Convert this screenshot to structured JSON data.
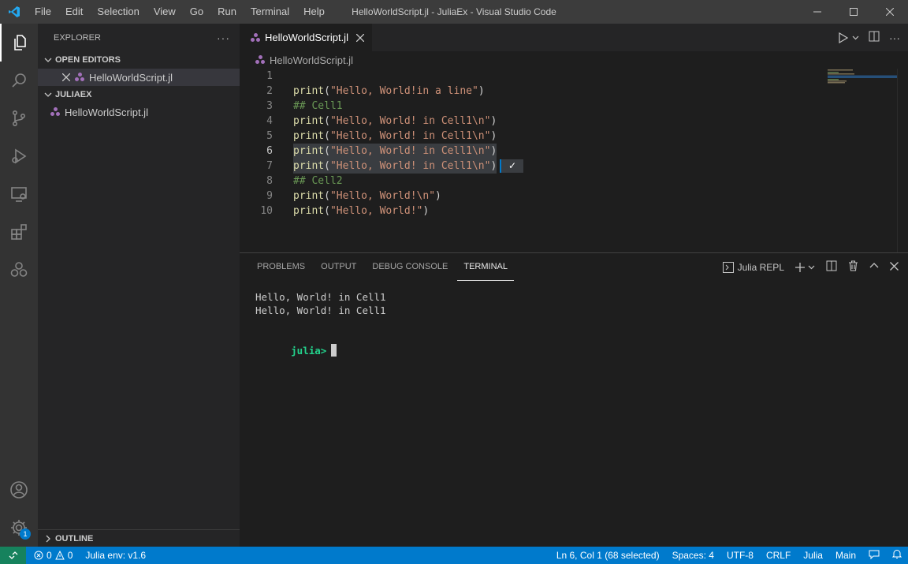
{
  "window": {
    "title": "HelloWorldScript.jl - JuliaEx - Visual Studio Code",
    "menu": [
      "File",
      "Edit",
      "Selection",
      "View",
      "Go",
      "Run",
      "Terminal",
      "Help"
    ]
  },
  "activity_bar": {
    "items": [
      "explorer-icon",
      "search-icon",
      "source-control-icon",
      "run-debug-icon",
      "remote-explorer-icon",
      "extensions-icon",
      "julia-icon"
    ],
    "bottom": [
      "account-icon",
      "settings-gear-icon"
    ],
    "settings_badge": "1"
  },
  "sidebar": {
    "title": "EXPLORER",
    "more": "···",
    "open_editors": {
      "label": "OPEN EDITORS",
      "items": [
        "HelloWorldScript.jl"
      ]
    },
    "workspace": {
      "label": "JULIAEX",
      "items": [
        "HelloWorldScript.jl"
      ]
    },
    "outline": "OUTLINE"
  },
  "editor": {
    "tab": "HelloWorldScript.jl",
    "breadcrumb": "HelloWorldScript.jl",
    "lines": [
      {
        "n": "1",
        "parts": []
      },
      {
        "n": "2",
        "parts": [
          {
            "c": "kw",
            "t": "print"
          },
          {
            "c": "pl",
            "t": "("
          },
          {
            "c": "str",
            "t": "\"Hello, World!in a line\""
          },
          {
            "c": "pl",
            "t": ")"
          }
        ]
      },
      {
        "n": "3",
        "parts": [
          {
            "c": "cm",
            "t": "## Cell1"
          }
        ]
      },
      {
        "n": "4",
        "parts": [
          {
            "c": "kw",
            "t": "print"
          },
          {
            "c": "pl",
            "t": "("
          },
          {
            "c": "str",
            "t": "\"Hello, World! in Cell1\\n\""
          },
          {
            "c": "pl",
            "t": ")"
          }
        ]
      },
      {
        "n": "5",
        "parts": [
          {
            "c": "kw",
            "t": "print"
          },
          {
            "c": "pl",
            "t": "("
          },
          {
            "c": "str",
            "t": "\"Hello, World! in Cell1\\n\""
          },
          {
            "c": "pl",
            "t": ")"
          }
        ]
      },
      {
        "n": "6",
        "parts": [
          {
            "c": "kw",
            "t": "print"
          },
          {
            "c": "pl",
            "t": "("
          },
          {
            "c": "str",
            "t": "\"Hello, World! in Cell1\\n\""
          },
          {
            "c": "pl",
            "t": ")"
          }
        ]
      },
      {
        "n": "7",
        "parts": [
          {
            "c": "kw",
            "t": "print"
          },
          {
            "c": "pl",
            "t": "("
          },
          {
            "c": "str",
            "t": "\"Hello, World! in Cell1\\n\""
          },
          {
            "c": "pl",
            "t": ")"
          }
        ]
      },
      {
        "n": "8",
        "parts": [
          {
            "c": "cm",
            "t": "## Cell2"
          }
        ]
      },
      {
        "n": "9",
        "parts": [
          {
            "c": "kw",
            "t": "print"
          },
          {
            "c": "pl",
            "t": "("
          },
          {
            "c": "str",
            "t": "\"Hello, World!\\n\""
          },
          {
            "c": "pl",
            "t": ")"
          }
        ]
      },
      {
        "n": "10",
        "parts": [
          {
            "c": "kw",
            "t": "print"
          },
          {
            "c": "pl",
            "t": "("
          },
          {
            "c": "str",
            "t": "\"Hello, World!\""
          },
          {
            "c": "pl",
            "t": ")"
          }
        ]
      }
    ],
    "current_line": "6",
    "selected_lines": [
      "6",
      "7"
    ],
    "inline_result": "✓"
  },
  "panel": {
    "tabs": [
      "PROBLEMS",
      "OUTPUT",
      "DEBUG CONSOLE",
      "TERMINAL"
    ],
    "active_tab": "TERMINAL",
    "terminal_name": "Julia REPL",
    "output": [
      "Hello, World! in Cell1",
      "Hello, World! in Cell1"
    ],
    "prompt": "julia>"
  },
  "status_bar": {
    "errors": "0",
    "warnings": "0",
    "julia_env": "Julia env: v1.6",
    "position": "Ln 6, Col 1 (68 selected)",
    "spaces": "Spaces: 4",
    "encoding": "UTF-8",
    "eol": "CRLF",
    "language": "Julia",
    "branch": "Main"
  },
  "colors": {
    "accent": "#007acc",
    "remote": "#16825d",
    "julia_purple": "#a270ba",
    "prompt_green": "#23d18b"
  }
}
